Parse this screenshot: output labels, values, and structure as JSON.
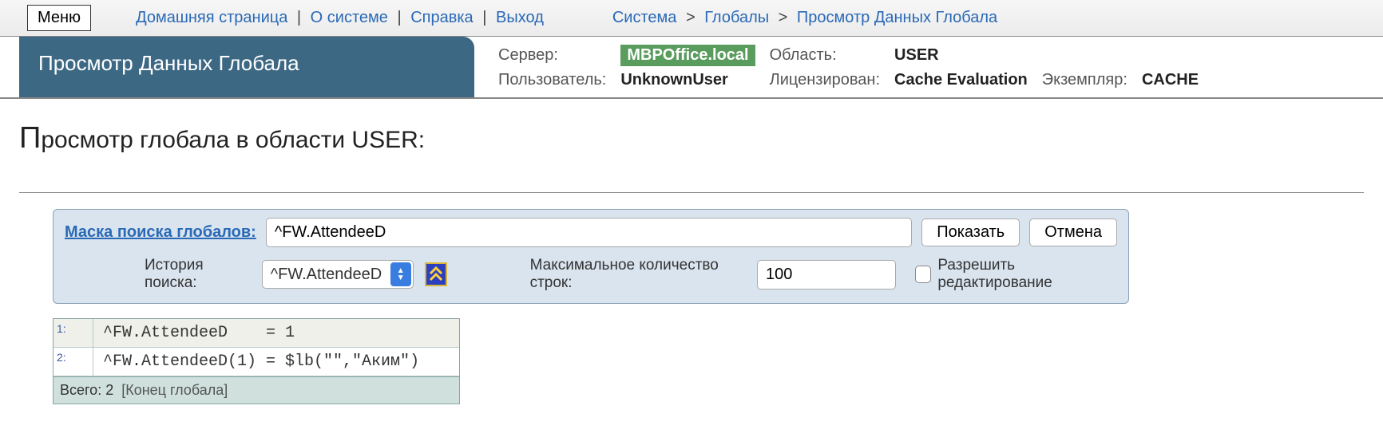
{
  "topbar": {
    "menu_label": "Меню",
    "links": {
      "home": "Домашняя страница",
      "about": "О системе",
      "help": "Справка",
      "logout": "Выход"
    },
    "breadcrumb": {
      "system": "Система",
      "globals": "Глобалы",
      "view": "Просмотр Данных Глобала"
    }
  },
  "page_title": "Просмотр Данных Глобала",
  "server_info": {
    "server_label": "Сервер:",
    "server_value": "MBPOffice.local",
    "namespace_label": "Область:",
    "namespace_value": "USER",
    "user_label": "Пользователь:",
    "user_value": "UnknownUser",
    "license_label": "Лицензирован:",
    "license_value": "Cache Evaluation",
    "instance_label": "Экземпляр:",
    "instance_value": "CACHE"
  },
  "main_heading": {
    "first": "П",
    "rest": "росмотр глобала в области USER:"
  },
  "search": {
    "mask_label": "Маска поиска глобалов:",
    "mask_value": "^FW.AttendeeD",
    "show_btn": "Показать",
    "cancel_btn": "Отмена",
    "history_label": "История поиска:",
    "history_selected": "^FW.AttendeeD",
    "maxrows_label": "Максимальное количество строк:",
    "maxrows_value": "100",
    "allow_edit_label": "Разрешить редактирование"
  },
  "results": {
    "rows": [
      {
        "n": "1:",
        "text": "^FW.AttendeeD    = 1"
      },
      {
        "n": "2:",
        "text": "^FW.AttendeeD(1) = $lb(\"\",\"Аким\")"
      }
    ],
    "total_label": "Всего: 2",
    "end_label": "[Конец глобала]"
  }
}
